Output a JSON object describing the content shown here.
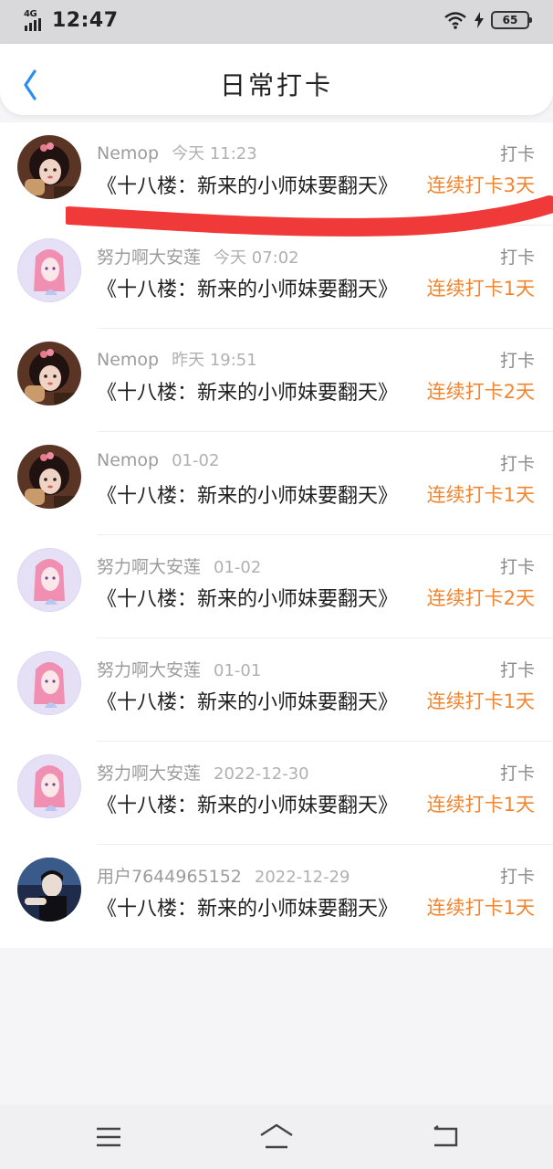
{
  "status_bar": {
    "network": "4G",
    "time": "12:47",
    "battery": "65",
    "icons": [
      "signal-icon",
      "wifi-icon",
      "charging-icon",
      "battery-icon"
    ]
  },
  "header": {
    "title": "日常打卡",
    "back_icon": "chevron-left-icon"
  },
  "checkins": [
    {
      "user": "Nemop",
      "time": "今天 11:23",
      "book": "《十八楼：新来的小师妹要翻天》",
      "action": "打卡",
      "streak": "连续打卡3天",
      "avatar": "nemop"
    },
    {
      "user": "努力啊大安莲",
      "time": "今天 07:02",
      "book": "《十八楼：新来的小师妹要翻天》",
      "action": "打卡",
      "streak": "连续打卡1天",
      "avatar": "anlian"
    },
    {
      "user": "Nemop",
      "time": "昨天 19:51",
      "book": "《十八楼：新来的小师妹要翻天》",
      "action": "打卡",
      "streak": "连续打卡2天",
      "avatar": "nemop"
    },
    {
      "user": "Nemop",
      "time": "01-02",
      "book": "《十八楼：新来的小师妹要翻天》",
      "action": "打卡",
      "streak": "连续打卡1天",
      "avatar": "nemop"
    },
    {
      "user": "努力啊大安莲",
      "time": "01-02",
      "book": "《十八楼：新来的小师妹要翻天》",
      "action": "打卡",
      "streak": "连续打卡2天",
      "avatar": "anlian"
    },
    {
      "user": "努力啊大安莲",
      "time": "01-01",
      "book": "《十八楼：新来的小师妹要翻天》",
      "action": "打卡",
      "streak": "连续打卡1天",
      "avatar": "anlian"
    },
    {
      "user": "努力啊大安莲",
      "time": "2022-12-30",
      "book": "《十八楼：新来的小师妹要翻天》",
      "action": "打卡",
      "streak": "连续打卡1天",
      "avatar": "anlian"
    },
    {
      "user": "用户7644965152",
      "time": "2022-12-29",
      "book": "《十八楼：新来的小师妹要翻天》",
      "action": "打卡",
      "streak": "连续打卡1天",
      "avatar": "user764"
    }
  ],
  "colors": {
    "accent": "#2a8ef0",
    "streak": "#f2852f",
    "annotation_strike": "#f03a3a"
  },
  "nav_bar": {
    "icons": [
      "menu-icon",
      "home-icon",
      "back-icon"
    ]
  }
}
